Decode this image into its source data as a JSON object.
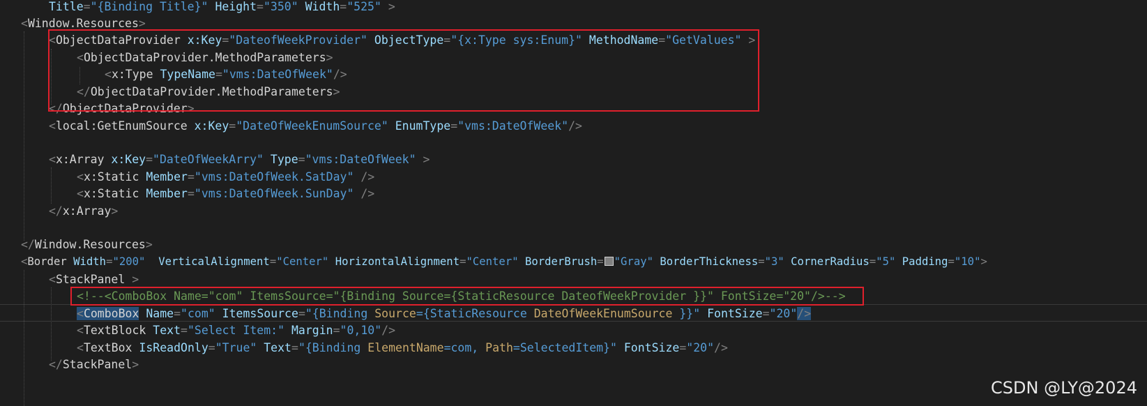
{
  "code": {
    "l1": {
      "a1": "Title",
      "s1": "\"{Binding Title}\"",
      "a2": "Height",
      "s2": "\"350\"",
      "a3": "Width",
      "s3": "\"525\""
    },
    "l2": {
      "tag": "Window.Resources"
    },
    "l3": {
      "tag": "ObjectDataProvider",
      "a1": "x:Key",
      "s1": "\"DateofWeekProvider\"",
      "a2": "ObjectType",
      "s2": "\"{x:Type sys:Enum}\"",
      "a3": "MethodName",
      "s3": "\"GetValues\""
    },
    "l4": {
      "tag": "ObjectDataProvider.MethodParameters"
    },
    "l5": {
      "tag": "x:Type",
      "a1": "TypeName",
      "s1": "\"vms:DateOfWeek\""
    },
    "l6": {
      "tag": "ObjectDataProvider.MethodParameters"
    },
    "l7": {
      "tag": "ObjectDataProvider"
    },
    "l8": {
      "tag": "local:GetEnumSource",
      "a1": "x:Key",
      "s1": "\"DateOfWeekEnumSource\"",
      "a2": "EnumType",
      "s2": "\"vms:DateOfWeek\""
    },
    "l9": {
      "tag": "x:Array",
      "a1": "x:Key",
      "s1": "\"DateOfWeekArry\"",
      "a2": "Type",
      "s2": "\"vms:DateOfWeek\""
    },
    "l10": {
      "tag": "x:Static",
      "a1": "Member",
      "s1": "\"vms:DateOfWeek.SatDay\""
    },
    "l11": {
      "tag": "x:Static",
      "a1": "Member",
      "s1": "\"vms:DateOfWeek.SunDay\""
    },
    "l12": {
      "tag": "x:Array"
    },
    "l13": {
      "tag": "Window.Resources"
    },
    "l14": {
      "tag": "Border",
      "a1": "Width",
      "s1": "\"200\"",
      "a2": "VerticalAlignment",
      "s2": "\"Center\"",
      "a3": "HorizontalAlignment",
      "s3": "\"Center\"",
      "a4": "BorderBrush",
      "s4": "\"Gray\"",
      "a5": "BorderThickness",
      "s5": "\"3\"",
      "a6": "CornerRadius",
      "s6": "\"5\"",
      "a7": "Padding",
      "s7": "\"10\""
    },
    "l15": {
      "tag": "StackPanel"
    },
    "l16": {
      "comment": "<!--<ComboBox Name=\"com\" ItemsSource=\"{Binding Source={StaticResource DateofWeekProvider }}\" FontSize=\"20\"/>-->"
    },
    "l17": {
      "tag": "ComboBox",
      "a1": "Name",
      "s1": "\"com\"",
      "a2": "ItemsSource",
      "s2a": "\"{Binding ",
      "b1": "Source",
      "s2b": "={StaticResource ",
      "b2": "DateOfWeekEnumSource",
      "s2c": " }}\"",
      "a3": "FontSize",
      "s3": "\"20\""
    },
    "l18": {
      "tag": "TextBlock",
      "a1": "Text",
      "s1": "\"Select Item:\"",
      "a2": "Margin",
      "s2": "\"0,10\""
    },
    "l19": {
      "tag": "TextBox",
      "a1": "IsReadOnly",
      "s1": "\"True\"",
      "a2": "Text",
      "s2a": "\"{Binding ",
      "b1": "ElementName",
      "s2b": "=com, ",
      "b2": "Path",
      "s2c": "=SelectedItem}\"",
      "a3": "FontSize",
      "s3": "\"20\""
    },
    "l20": {
      "tag": "StackPanel"
    }
  },
  "watermark": "CSDN @LY@2024",
  "colors": {
    "background": "#1e1e1e",
    "highlight_box": "#e0202c",
    "selection": "#264f78"
  }
}
